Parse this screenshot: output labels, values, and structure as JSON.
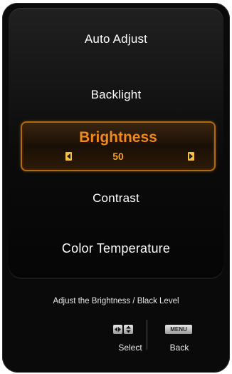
{
  "menu": {
    "items": [
      {
        "label": "Auto  Adjust"
      },
      {
        "label": "Backlight"
      },
      {
        "label": "Brightness",
        "value": "50",
        "selected": true
      },
      {
        "label": "Contrast"
      },
      {
        "label": "Color  Temperature"
      }
    ]
  },
  "hint": "Adjust the Brightness / Black Level",
  "footer": {
    "select_icon": "navigation-arrows-icon",
    "select_label": "Select",
    "menu_icon_text": "MENU",
    "back_label": "Back"
  },
  "colors": {
    "highlight_text": "#f0891a",
    "highlight_border": "#b06a12",
    "arrow": "#f5c040"
  }
}
